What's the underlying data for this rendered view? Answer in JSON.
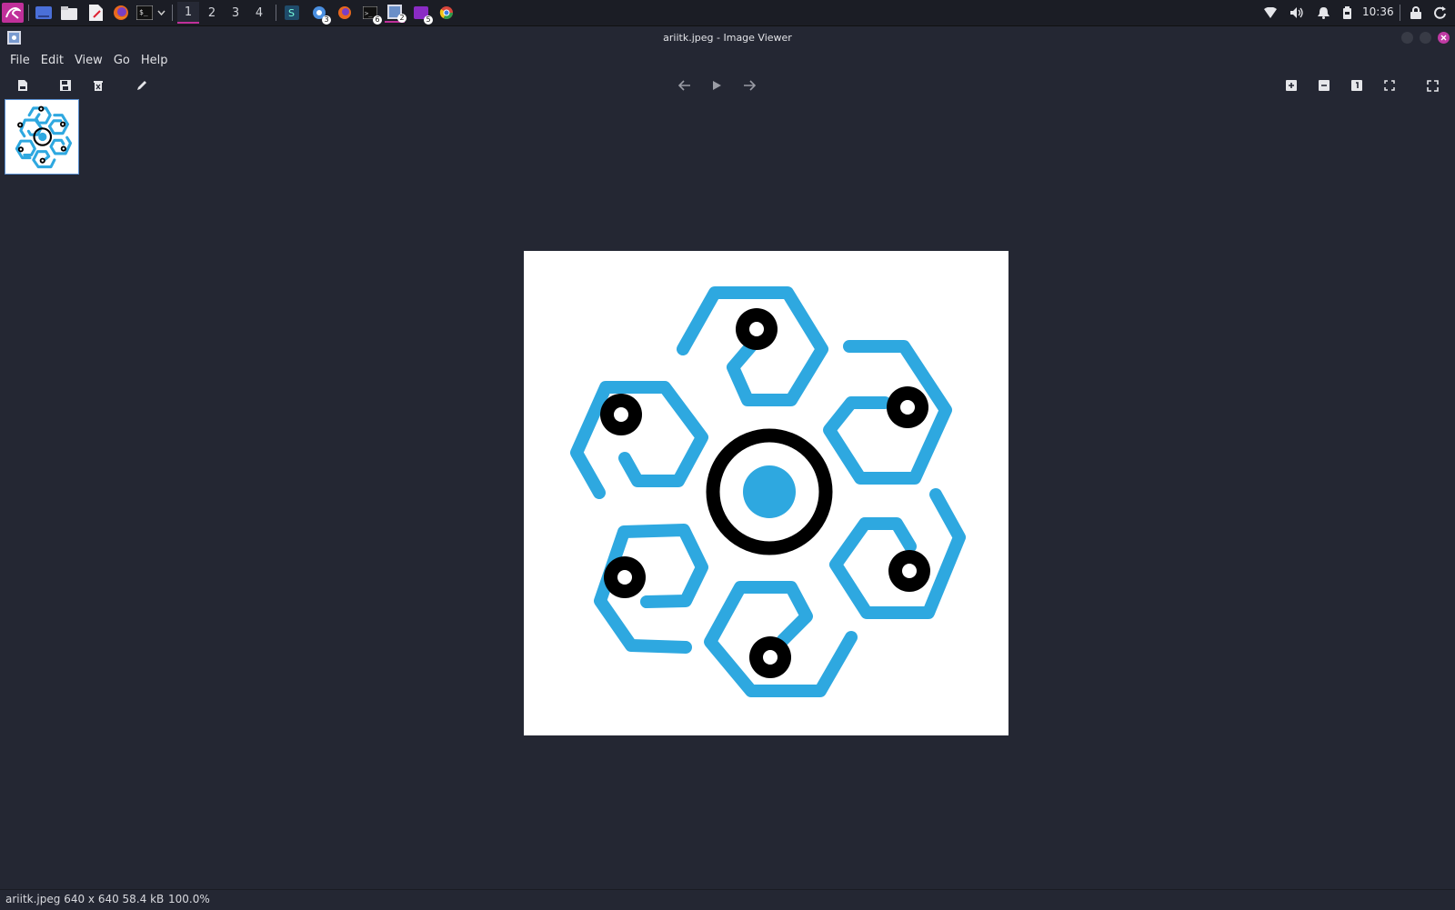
{
  "taskbar": {
    "workspaces": [
      "1",
      "2",
      "3",
      "4"
    ],
    "active_workspace": "1",
    "badges": {
      "chrome": "3",
      "terminal": "6",
      "viewer": "2",
      "app": "5"
    },
    "clock": "10:36"
  },
  "window": {
    "title": "ariitk.jpeg - Image Viewer"
  },
  "menu": [
    "File",
    "Edit",
    "View",
    "Go",
    "Help"
  ],
  "status": {
    "file_info": "ariitk.jpeg  640 x 640  58.4 kB",
    "zoom": "100.0%"
  },
  "image": {
    "colors": {
      "blue": "#2ea8e0",
      "black": "#000000"
    }
  }
}
